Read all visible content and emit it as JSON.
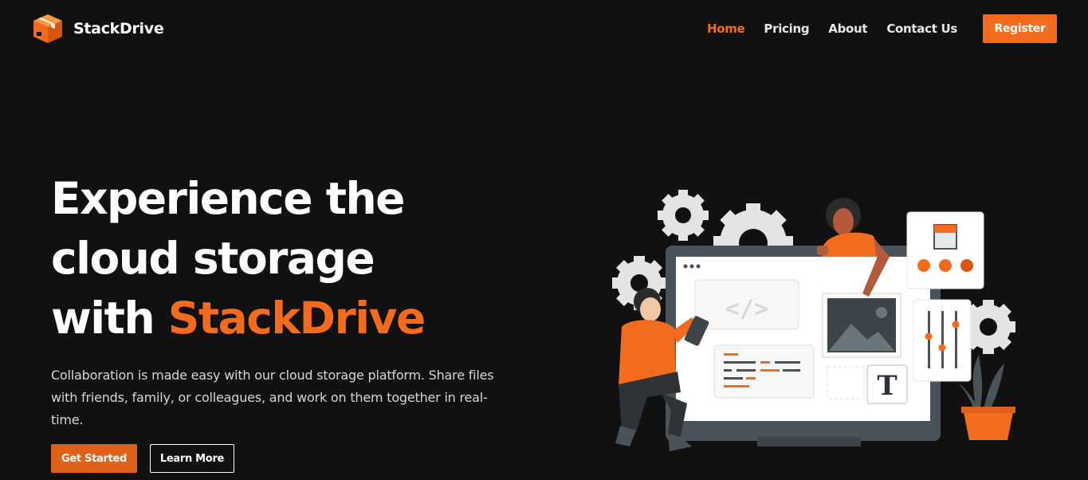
{
  "header": {
    "brand": "StackDrive",
    "nav": [
      "Home",
      "Pricing",
      "About",
      "Contact Us"
    ],
    "register_label": "Register"
  },
  "hero": {
    "title_line1": "Experience the",
    "title_line2": "cloud storage",
    "title_line3_prefix": "with ",
    "title_line3_accent": "StackDrive",
    "description": "Collaboration is made easy with our cloud storage platform. Share files with friends, family, or colleagues, and work on them together in real-time.",
    "primary_button": "Get Started",
    "secondary_button": "Learn More"
  },
  "illustration": {
    "code_label": "</>",
    "type_label": "T"
  },
  "colors": {
    "accent": "#f36b1c",
    "background": "#111111",
    "text": "#ffffff"
  },
  "icons": [
    "box-logo-icon",
    "gear-icon"
  ]
}
